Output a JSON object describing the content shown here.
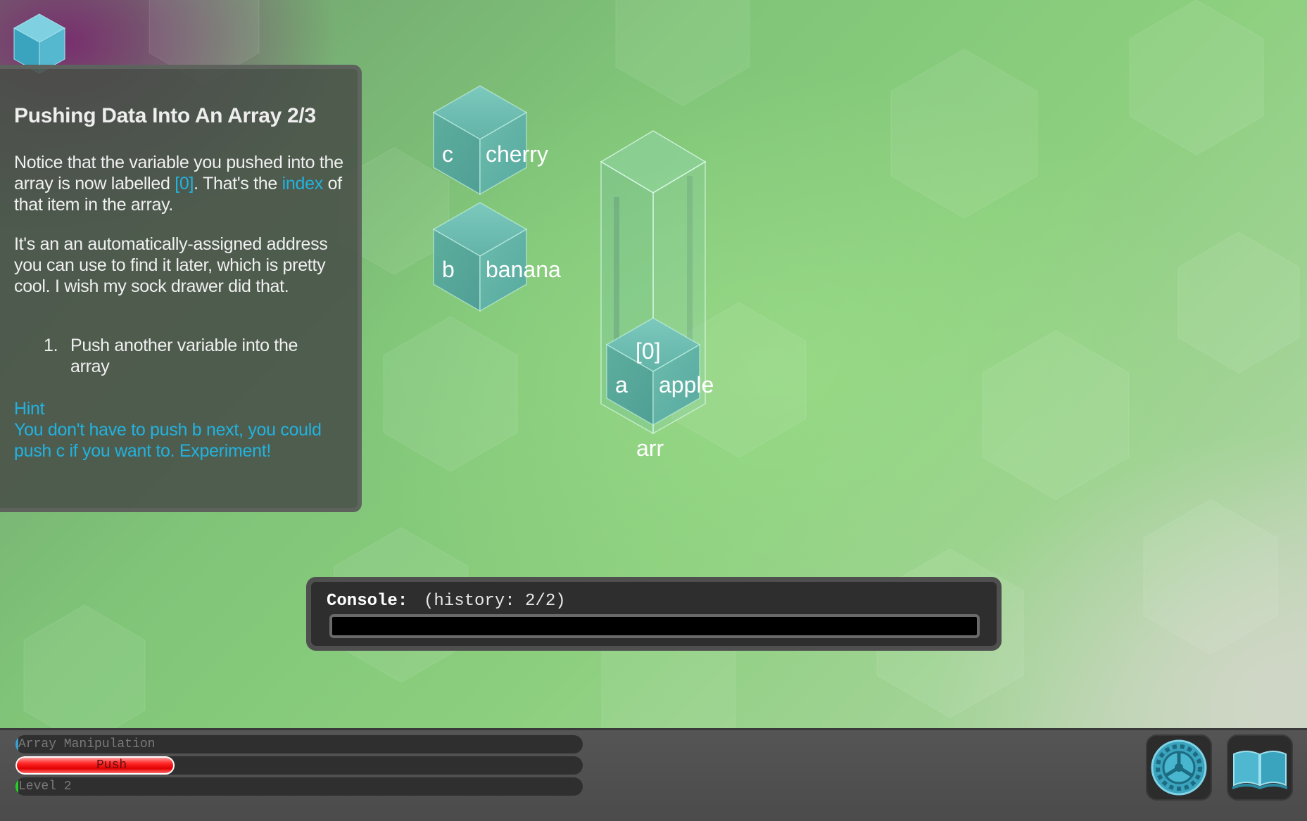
{
  "colors": {
    "accent": "#22b2e0",
    "cube_fill": "#5fb3a8",
    "panel_bg": "#484e48",
    "progress_push": "#ff2a2a",
    "progress_level": "#26d026"
  },
  "logo": {
    "icon": "cube-logo-icon"
  },
  "lesson": {
    "title": "Pushing Data Into An Array 2/3",
    "p1_a": "Notice that the variable you pushed into the array is now labelled ",
    "p1_link": "[0]",
    "p1_b": ". That's the ",
    "p1_link2": "index",
    "p1_c": " of that item in the array.",
    "p2": "It's an an automatically-assigned address you can use to find it later, which is pretty cool. I wish my sock drawer did that.",
    "steps": [
      {
        "num": "1.",
        "text": "Push another variable into the array"
      }
    ],
    "hint_title": "Hint",
    "hint_text": "You don't have to push b next, you could push c if you want to. Experiment!"
  },
  "variables": [
    {
      "short": "c",
      "value": "cherry"
    },
    {
      "short": "b",
      "value": "banana"
    }
  ],
  "array": {
    "name": "arr",
    "items": [
      {
        "index": "[0]",
        "short": "a",
        "value": "apple"
      }
    ]
  },
  "console": {
    "label": "Console:",
    "history": "(history: 2/2)",
    "input_value": ""
  },
  "progress": [
    {
      "label": "Array Manipulation",
      "fraction": 0.0
    },
    {
      "label": "Push",
      "fraction": 0.28
    },
    {
      "label": "Level 2",
      "fraction": 0.0
    }
  ],
  "buttons": {
    "settings_icon": "gear-icon",
    "codex_icon": "book-icon"
  }
}
